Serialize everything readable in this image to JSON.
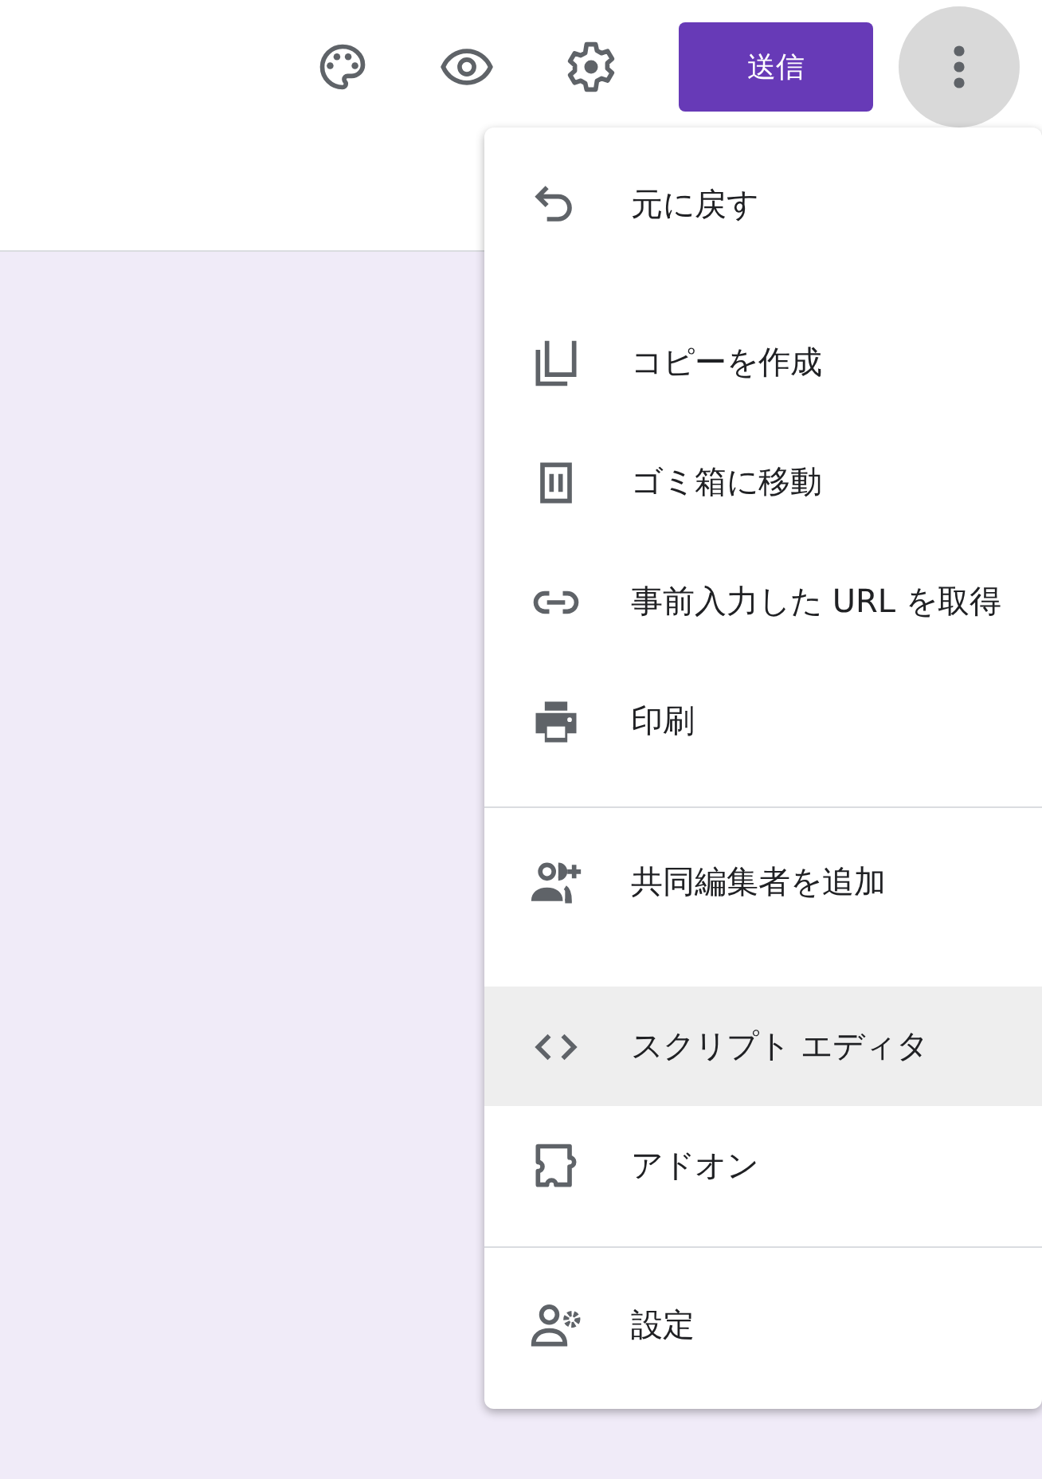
{
  "header": {
    "send_button": "送信",
    "more_button": {
      "pressed": true
    }
  },
  "menu": {
    "groups": [
      [
        {
          "kind": "undo",
          "label": "元に戻す",
          "highlighted": false
        },
        {
          "kind": "copy",
          "label": "コピーを作成",
          "highlighted": false
        },
        {
          "kind": "trash",
          "label": "ゴミ箱に移動",
          "highlighted": false
        },
        {
          "kind": "link",
          "label": "事前入力した URL を取得",
          "highlighted": false
        },
        {
          "kind": "print",
          "label": "印刷",
          "highlighted": false
        }
      ],
      [
        {
          "kind": "people-add",
          "label": "共同編集者を追加",
          "highlighted": false
        },
        {
          "kind": "code",
          "label": "スクリプト エディタ",
          "highlighted": true
        },
        {
          "kind": "puzzle",
          "label": "アドオン",
          "highlighted": false
        }
      ],
      [
        {
          "kind": "person-gear",
          "label": "設定",
          "highlighted": false
        }
      ]
    ]
  }
}
